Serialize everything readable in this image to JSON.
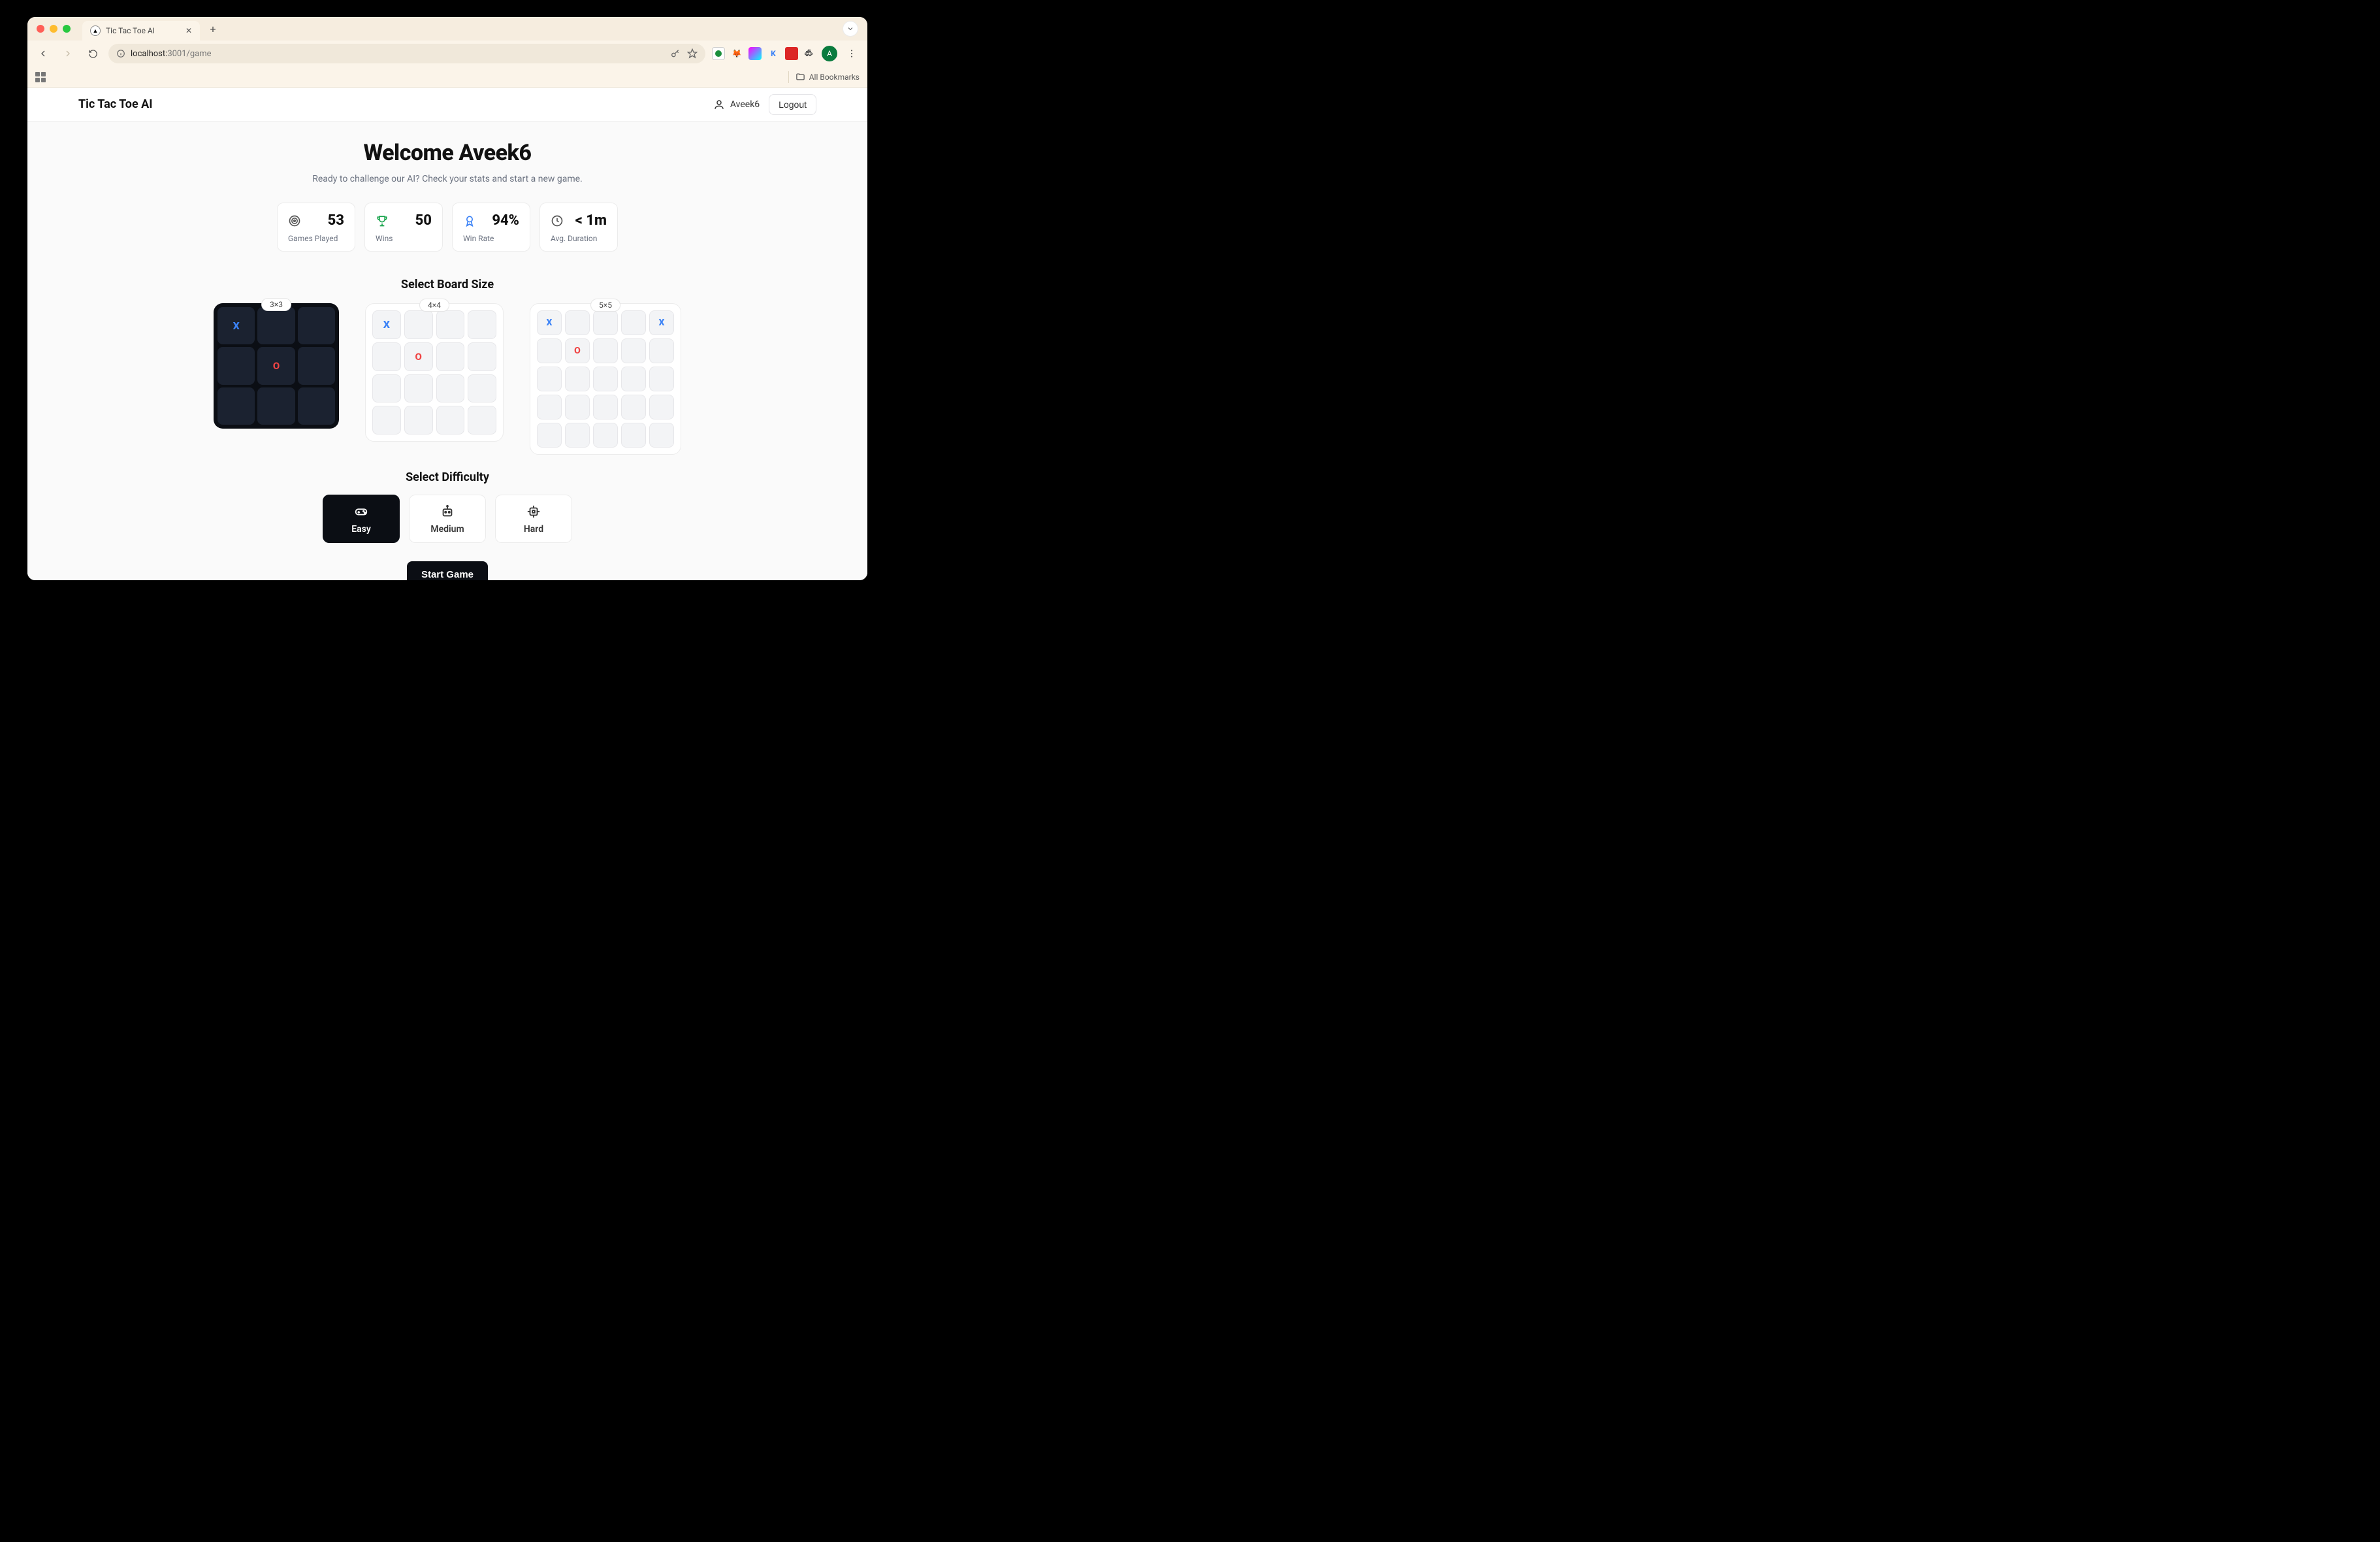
{
  "browser": {
    "tab_title": "Tic Tac Toe AI",
    "url_host": "localhost:",
    "url_port_path": "3001/game",
    "bookmarks_label": "All Bookmarks",
    "profile_initial": "A"
  },
  "header": {
    "brand": "Tic Tac Toe AI",
    "username": "Aveek6",
    "logout": "Logout"
  },
  "hero": {
    "welcome": "Welcome Aveek6",
    "subtitle": "Ready to challenge our AI? Check your stats and start a new game."
  },
  "stats": {
    "games_played": {
      "value": "53",
      "label": "Games Played"
    },
    "wins": {
      "value": "50",
      "label": "Wins"
    },
    "win_rate": {
      "value": "94%",
      "label": "Win Rate"
    },
    "avg_duration": {
      "value": "< 1m",
      "label": "Avg. Duration"
    }
  },
  "board": {
    "section_title": "Select Board Size",
    "badge_3": "3×3",
    "badge_4": "4×4",
    "badge_5": "5×5",
    "x": "X",
    "o": "O"
  },
  "difficulty": {
    "section_title": "Select Difficulty",
    "easy": "Easy",
    "medium": "Medium",
    "hard": "Hard"
  },
  "cta": {
    "start": "Start Game"
  }
}
